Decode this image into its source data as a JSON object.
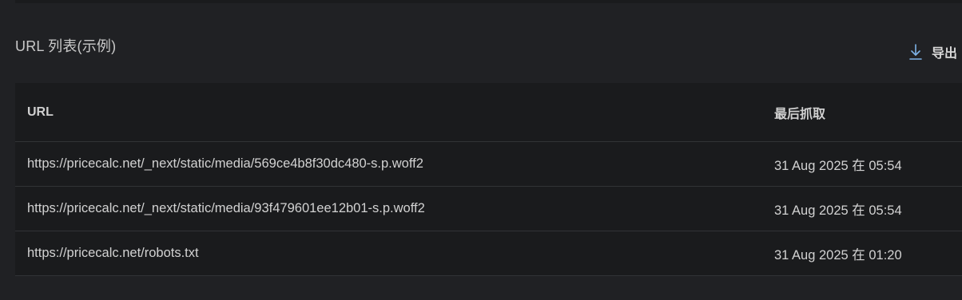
{
  "section": {
    "title": "URL 列表(示例)"
  },
  "toolbar": {
    "export_label": "导出",
    "export_icon": "download-icon",
    "export_icon_color": "#7eb3e8"
  },
  "table": {
    "headers": {
      "url": "URL",
      "last_crawled": "最后抓取"
    },
    "rows": [
      {
        "url": "https://pricecalc.net/_next/static/media/569ce4b8f30dc480-s.p.woff2",
        "last_crawled": "31 Aug 2025 在 05:54"
      },
      {
        "url": "https://pricecalc.net/_next/static/media/93f479601ee12b01-s.p.woff2",
        "last_crawled": "31 Aug 2025 在 05:54"
      },
      {
        "url": "https://pricecalc.net/robots.txt",
        "last_crawled": "31 Aug 2025 在 01:20"
      }
    ]
  },
  "colors": {
    "background": "#202124",
    "table_background": "#1a1b1d",
    "divider": "#313336",
    "text": "#d2d2d2"
  }
}
